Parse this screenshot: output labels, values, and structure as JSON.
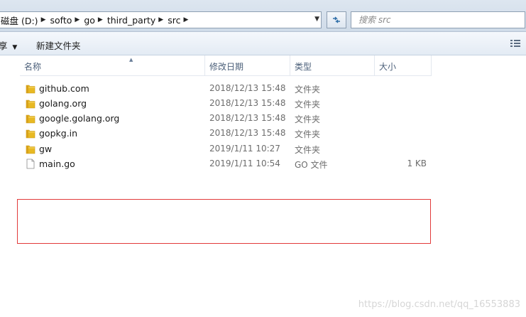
{
  "address": {
    "crumbs": [
      "磁盘 (D:)",
      "softo",
      "go",
      "third_party",
      "src"
    ],
    "dropdown_icon": "chevron-down-icon"
  },
  "search": {
    "placeholder": "搜索 src"
  },
  "toolbar": {
    "share_label": "享",
    "new_folder_label": "新建文件夹"
  },
  "columns": {
    "name": "名称",
    "modified": "修改日期",
    "type": "类型",
    "size": "大小"
  },
  "files": [
    {
      "name": "github.com",
      "modified": "2018/12/13 15:48",
      "type": "文件夹",
      "size": "",
      "icon": "folder-icon"
    },
    {
      "name": "golang.org",
      "modified": "2018/12/13 15:48",
      "type": "文件夹",
      "size": "",
      "icon": "folder-icon"
    },
    {
      "name": "google.golang.org",
      "modified": "2018/12/13 15:48",
      "type": "文件夹",
      "size": "",
      "icon": "folder-icon"
    },
    {
      "name": "gopkg.in",
      "modified": "2018/12/13 15:48",
      "type": "文件夹",
      "size": "",
      "icon": "folder-icon"
    },
    {
      "name": "gw",
      "modified": "2019/1/11 10:27",
      "type": "文件夹",
      "size": "",
      "icon": "folder-icon"
    },
    {
      "name": "main.go",
      "modified": "2019/1/11 10:54",
      "type": "GO 文件",
      "size": "1 KB",
      "icon": "file-icon"
    }
  ],
  "watermark": "https://blog.csdn.net/qq_16553883",
  "colors": {
    "highlight": "#e23b3b",
    "folder": "#e8b923"
  }
}
